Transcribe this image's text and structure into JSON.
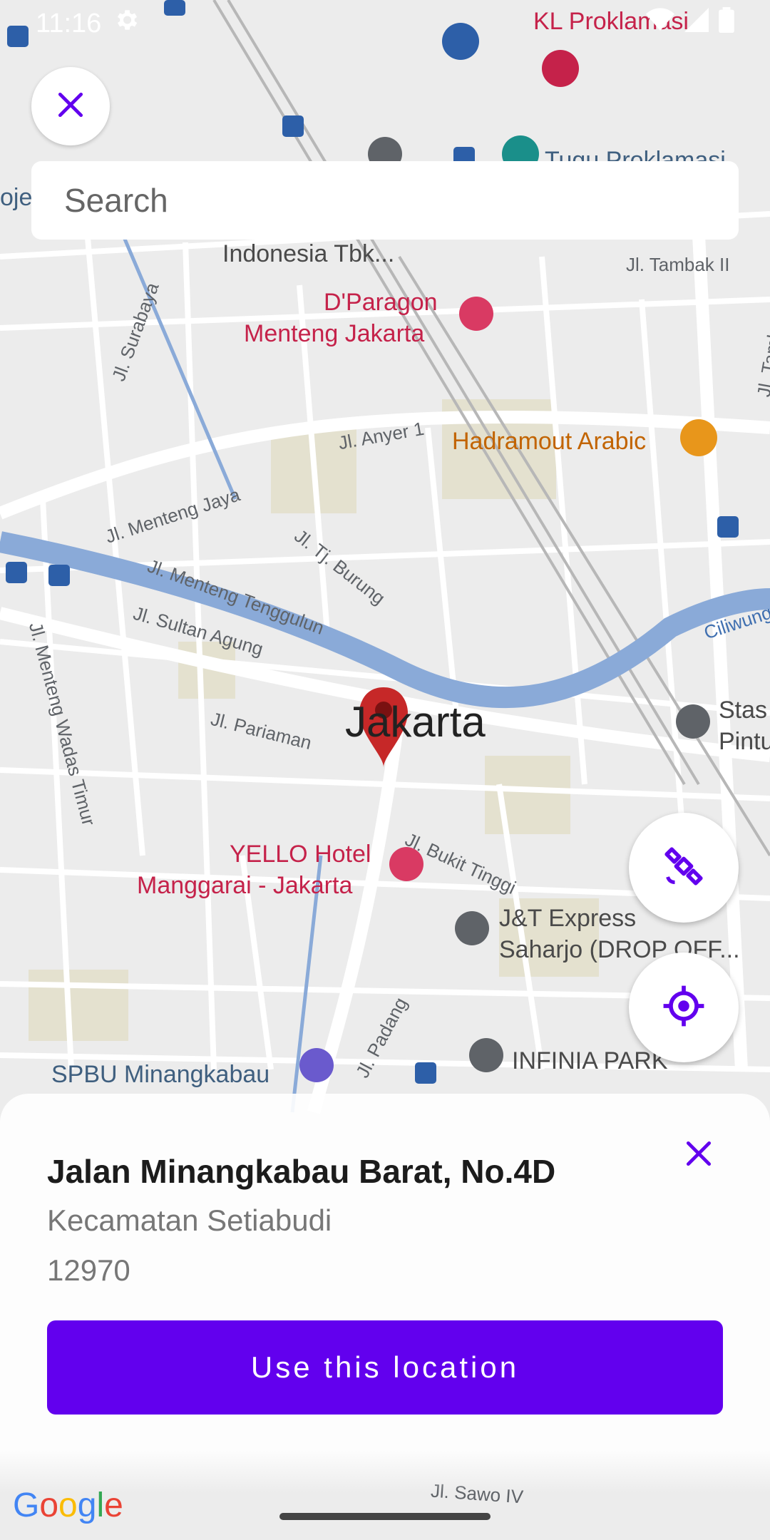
{
  "status_bar": {
    "time": "11:16",
    "icons": [
      "settings-icon",
      "wifi-icon",
      "signal-icon",
      "battery-icon"
    ]
  },
  "search": {
    "placeholder": "Search"
  },
  "map": {
    "city_label": "Jakarta",
    "streets": [
      "Jl. Tambak II",
      "Jl. Tambak",
      "Jl. Anyer 1",
      "Jl. Menteng Jaya",
      "Jl. Tj. Burung",
      "Jl. Menteng Tenggulun",
      "Jl. Sultan Agung",
      "Jl. Menteng Wadas Timur",
      "Jl. Pariaman",
      "Jl. Bukit Tinggi",
      "Jl. Padang",
      "Jl. Sawo IV",
      "Jl. Surabaya",
      "Ciliwung"
    ],
    "pois": {
      "kl_prok": "KL Proklamasi",
      "tugu": "Tugu Proklamasi",
      "indonesia": "Indonesia Tbk...",
      "dparagon_1": "D'Paragon",
      "dparagon_2": "Menteng Jakarta",
      "hadramout": "Hadramout Arabic",
      "yello_1": "YELLO Hotel",
      "yello_2": "Manggarai - Jakarta",
      "jnt_1": "J&T Express",
      "jnt_2": "Saharjo (DROP OFF...",
      "spbu": "SPBU Minangkabau",
      "infinia": "INFINIA PARK",
      "stas_1": "Stas",
      "stas_2": "Pintu",
      "proj": "oje"
    },
    "attribution": "Google"
  },
  "colors": {
    "accent": "#6200ee",
    "pin": "#c62828",
    "water": "#8aaad8"
  },
  "sheet": {
    "title": "Jalan Minangkabau Barat, No.4D",
    "subtitle": "Kecamatan Setiabudi",
    "postcode": "12970",
    "action_label": "Use this location"
  }
}
